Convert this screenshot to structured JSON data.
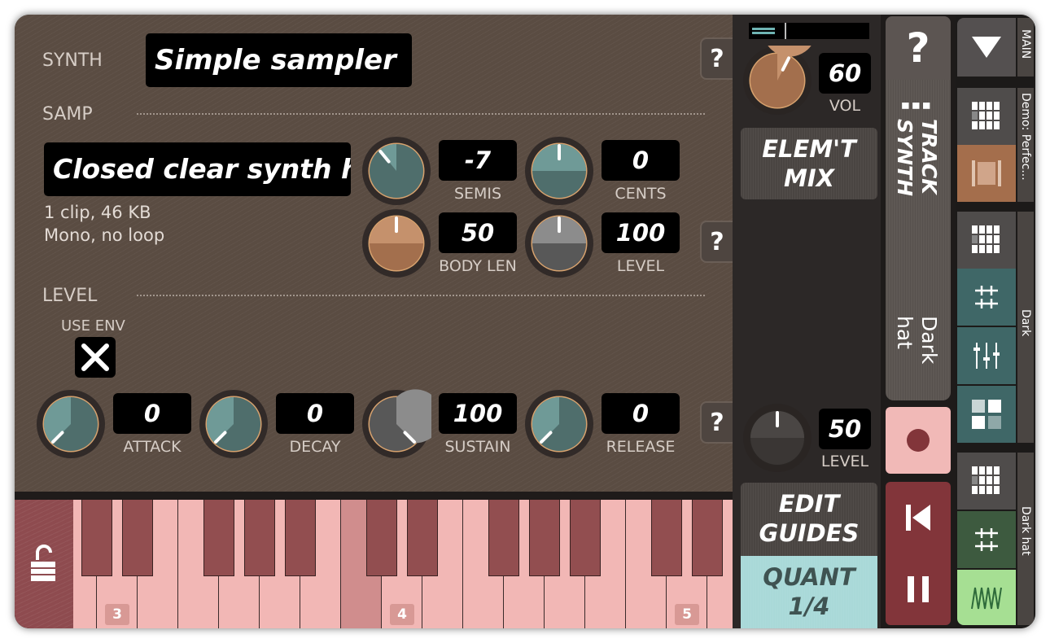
{
  "synth": {
    "label": "SYNTH",
    "name": "Simple sampler"
  },
  "samp": {
    "label": "SAMP",
    "sample_name": "Closed clear synth h",
    "info_line1": "1 clip, 46 KB",
    "info_line2": "Mono, no loop",
    "semis": {
      "value": "-7",
      "label": "SEMIS"
    },
    "cents": {
      "value": "0",
      "label": "CENTS"
    },
    "body_len": {
      "value": "50",
      "label": "BODY LEN"
    },
    "level": {
      "value": "100",
      "label": "LEVEL"
    }
  },
  "level_section": {
    "label": "LEVEL",
    "use_env_label": "USE ENV",
    "use_env_checked": true,
    "attack": {
      "value": "0",
      "label": "ATTACK"
    },
    "decay": {
      "value": "0",
      "label": "DECAY"
    },
    "sustain": {
      "value": "100",
      "label": "SUSTAIN"
    },
    "release": {
      "value": "0",
      "label": "RELEASE"
    }
  },
  "help_label": "?",
  "keyboard": {
    "octave_labels": [
      "3",
      "4",
      "5"
    ],
    "locked": false
  },
  "mixer": {
    "vol": {
      "value": "60",
      "label": "VOL"
    },
    "elem_mix_line1": "ELEM'T",
    "elem_mix_line2": "MIX",
    "level": {
      "value": "50",
      "label": "LEVEL"
    },
    "edit_guides_line1": "EDIT",
    "edit_guides_line2": "GUIDES",
    "quant_line1": "QUANT",
    "quant_line2": "1/4"
  },
  "track": {
    "help_label": "?",
    "menu_glyph": "⋮",
    "track_synth_label": "TRACK\nSYNTH",
    "track_name": "Dark\nhat"
  },
  "sidebar": {
    "main_label": "MAIN",
    "group1_label": "Demo: Perfec...",
    "group2_label": "Dark",
    "group3_label": "Dark hat"
  },
  "colors": {
    "panel_bg": "#5a4c42",
    "teal_knob": "#4f6e6c",
    "tan_knob": "#a36f4d",
    "gray_knob": "#585858",
    "white_key": "#f2b7b5",
    "black_key": "#924e50",
    "record_bg": "#f1b9b7",
    "transport_bg": "#82353a",
    "quant_bg": "#a9d9d8",
    "teal_btn": "#3f6767",
    "green_btn": "#3d5a3f",
    "light_green_btn": "#a6df93"
  }
}
